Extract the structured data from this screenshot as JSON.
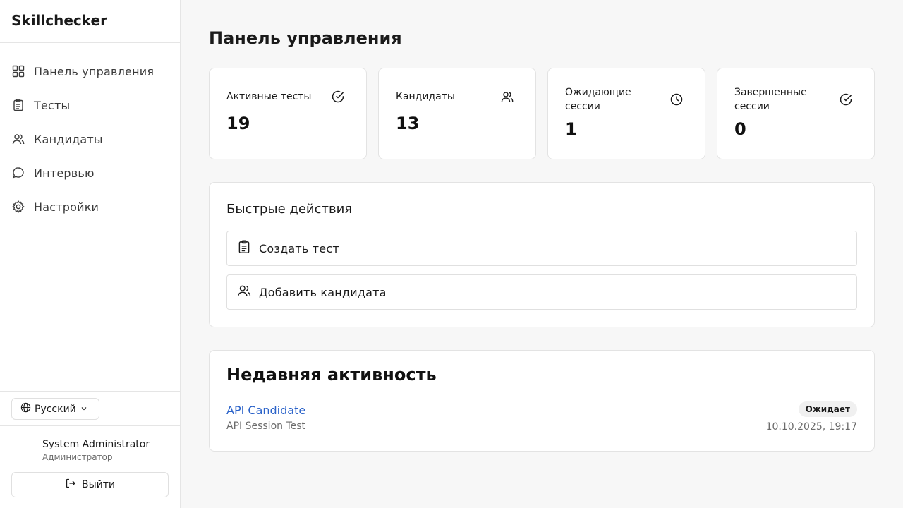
{
  "app": {
    "title": "Skillchecker"
  },
  "sidebar": {
    "items": [
      {
        "label": "Панель управления",
        "icon": "dashboard-icon"
      },
      {
        "label": "Тесты",
        "icon": "clipboard-icon"
      },
      {
        "label": "Кандидаты",
        "icon": "users-icon"
      },
      {
        "label": "Интервью",
        "icon": "chat-bubble-icon"
      },
      {
        "label": "Настройки",
        "icon": "gear-icon"
      }
    ],
    "language": {
      "label": "Русский",
      "icon": "globe-icon"
    },
    "user": {
      "name": "System Administrator",
      "role": "Администратор"
    },
    "logout_label": "Выйти"
  },
  "main": {
    "title": "Панель управления",
    "stats": [
      {
        "label": "Активные тесты",
        "value": "19",
        "icon": "check-circle-icon"
      },
      {
        "label": "Кандидаты",
        "value": "13",
        "icon": "users-icon"
      },
      {
        "label": "Ожидающие сессии",
        "value": "1",
        "icon": "clock-icon"
      },
      {
        "label": "Завершенные сессии",
        "value": "0",
        "icon": "check-circle-icon"
      }
    ],
    "quick_actions": {
      "title": "Быстрые действия",
      "items": [
        {
          "label": "Создать тест",
          "icon": "clipboard-icon"
        },
        {
          "label": "Добавить кандидата",
          "icon": "users-icon"
        }
      ]
    },
    "recent_activity": {
      "title": "Недавняя активность",
      "items": [
        {
          "name": "API Candidate",
          "subtitle": "API Session Test",
          "status": "Ожидает",
          "date": "10.10.2025, 19:17"
        }
      ]
    }
  },
  "colors": {
    "link": "#2a62c9",
    "border": "#e3e3e3",
    "background": "#f7f7f7",
    "badge_bg": "#f0f0f0"
  }
}
